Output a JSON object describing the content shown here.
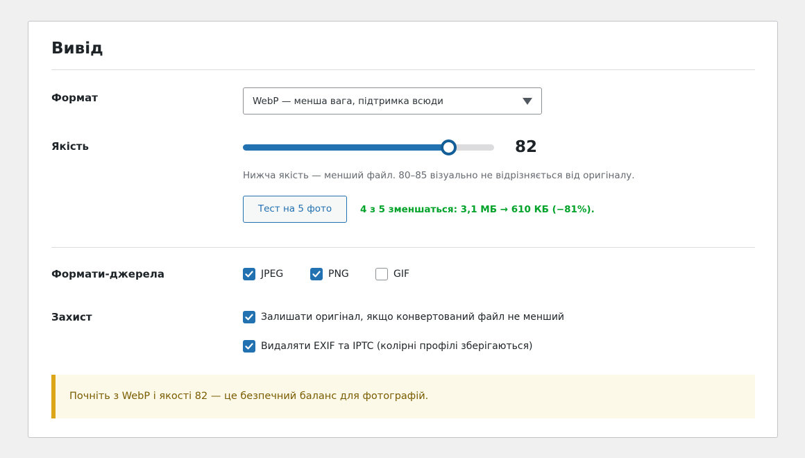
{
  "section": {
    "title": "Вивід"
  },
  "format": {
    "label": "Формат",
    "selected": "WebP — менша вага, підтримка всюди"
  },
  "quality": {
    "label": "Якість",
    "value": "82",
    "level_percent": 82,
    "hint": "Нижча якість — менший файл. 80–85 візуально не відрізняється від оригіналу.",
    "test_button": "Тест на 5 фото",
    "test_result": "4 з 5 зменшаться: 3,1 МБ → 610 КБ (−81%)."
  },
  "sources": {
    "label": "Формати-джерела",
    "options": [
      {
        "label": "JPEG",
        "checked": true
      },
      {
        "label": "PNG",
        "checked": true
      },
      {
        "label": "GIF",
        "checked": false
      }
    ]
  },
  "protection": {
    "label": "Захист",
    "options": [
      {
        "label": "Залишати оригінал, якщо конвертований файл не менший",
        "checked": true
      },
      {
        "label": "Видаляти EXIF та IPTC (колірні профілі зберігаються)",
        "checked": true
      }
    ]
  },
  "notice": {
    "text": "Почніть з WebP і якості 82 — це безпечний баланс для фотографій."
  },
  "colors": {
    "accent": "#2271b1",
    "success": "#00a32a",
    "notice_border": "#dba617",
    "notice_bg": "#fcf9e8"
  }
}
